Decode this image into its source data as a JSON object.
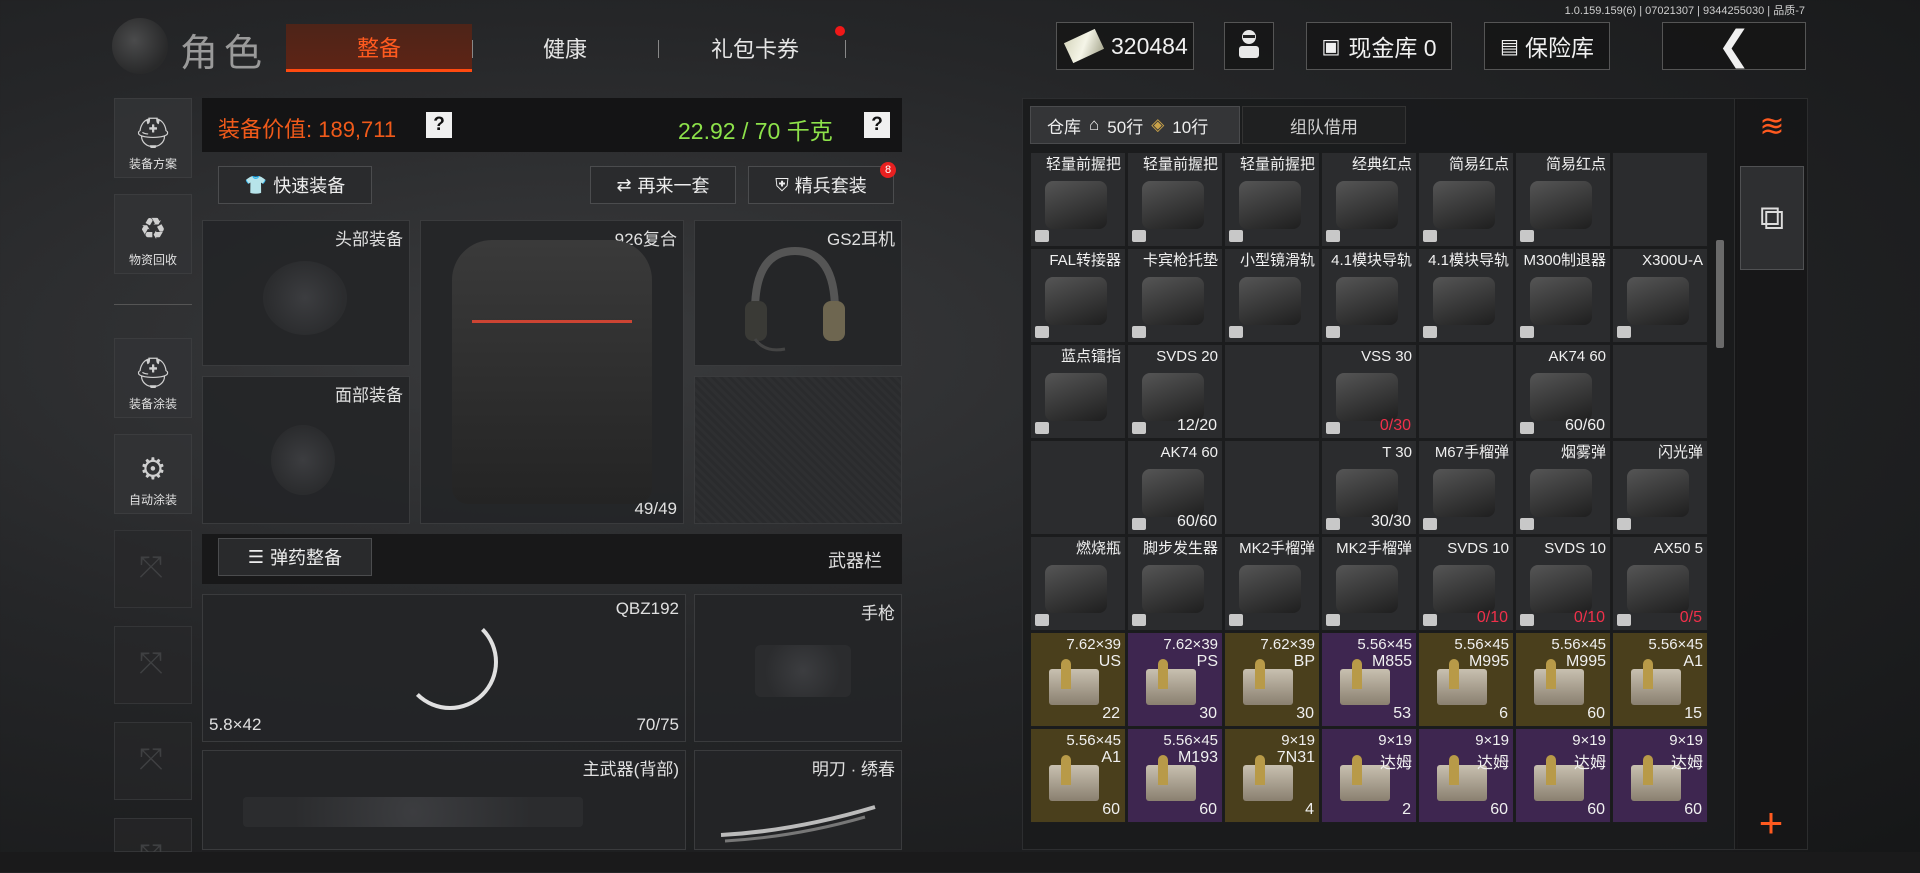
{
  "version": "1.0.159.159(6) | 07021307 | 9344255030 | 品质-7",
  "header": {
    "title": "角色",
    "tabs": [
      {
        "label": "整备",
        "active": true
      },
      {
        "label": "健康",
        "active": false
      },
      {
        "label": "礼包卡券",
        "active": false,
        "has_dot": true
      }
    ],
    "money": "320484",
    "cash_vault": "现金库 0",
    "safe": "保险库",
    "back_icon": "back-arrow-icon"
  },
  "sidebar": [
    {
      "label": "装备方案",
      "icon": "helmet-plan-icon"
    },
    {
      "label": "物资回收",
      "icon": "recycle-face-icon"
    },
    {
      "label": "装备涂装",
      "icon": "helmet-paint-icon"
    },
    {
      "label": "自动涂装",
      "icon": "brush-gear-icon"
    }
  ],
  "equipment": {
    "value_label": "装备价值: 189,711",
    "weight_label": "22.92 / 70 千克",
    "quick_equip": "快速装备",
    "again": "再来一套",
    "elite": "精兵套装",
    "elite_badge": "8",
    "slots": {
      "head": "头部装备",
      "face": "面部装备",
      "armor_name": "926复合",
      "armor_durability": "49/49",
      "ears": "GS2耳机",
      "ammo_btn": "弹药整备",
      "weapon_col": "武器栏",
      "primary_name": "QBZ192",
      "primary_caliber": "5.8×42",
      "primary_ammo": "70/75",
      "pistol": "手枪",
      "back_weapon": "主武器(背部)",
      "melee": "明刀 · 绣春"
    }
  },
  "storage": {
    "tab": "仓库",
    "rows": "50行",
    "rows2": "10行",
    "team_tab": "组队借用",
    "items": [
      {
        "name": "轻量前握把",
        "count": "",
        "tier": "gray"
      },
      {
        "name": "轻量前握把",
        "count": "",
        "tier": "gray"
      },
      {
        "name": "轻量前握把",
        "count": "",
        "tier": "gray"
      },
      {
        "name": "经典红点",
        "count": "",
        "tier": "gray"
      },
      {
        "name": "简易红点",
        "count": "",
        "tier": "gray"
      },
      {
        "name": "简易红点",
        "count": "",
        "tier": "gray"
      },
      {
        "name": "",
        "count": "",
        "tier": "gray"
      },
      {
        "name": "FAL转接器",
        "count": "",
        "tier": "gray"
      },
      {
        "name": "卡宾枪托垫",
        "count": "",
        "tier": "gray"
      },
      {
        "name": "小型镜滑轨",
        "count": "",
        "tier": "gray"
      },
      {
        "name": "4.1模块导轨",
        "count": "",
        "tier": "gray"
      },
      {
        "name": "4.1模块导轨",
        "count": "",
        "tier": "gray"
      },
      {
        "name": "M300制退器",
        "count": "",
        "tier": "gray"
      },
      {
        "name": "X300U-A",
        "count": "",
        "tier": "gray"
      },
      {
        "name": "蓝点镭指",
        "count": "",
        "tier": "gray"
      },
      {
        "name": "SVDS 20",
        "count": "12/20",
        "tier": "gray"
      },
      {
        "name": "",
        "count": "",
        "tier": "gray"
      },
      {
        "name": "VSS 30",
        "count": "0/30",
        "tier": "gray",
        "red": true
      },
      {
        "name": "",
        "count": "",
        "tier": "gray"
      },
      {
        "name": "AK74 60",
        "count": "60/60",
        "tier": "gray"
      },
      {
        "name": "",
        "count": "",
        "tier": "gray"
      },
      {
        "name": "",
        "count": "",
        "tier": "gray"
      },
      {
        "name": "AK74 60",
        "count": "60/60",
        "tier": "gray"
      },
      {
        "name": "",
        "count": "",
        "tier": "gray"
      },
      {
        "name": "T 30",
        "count": "30/30",
        "tier": "gray"
      },
      {
        "name": "M67手榴弹",
        "count": "",
        "tier": "gray"
      },
      {
        "name": "烟雾弹",
        "count": "",
        "tier": "gray"
      },
      {
        "name": "闪光弹",
        "count": "",
        "tier": "gray"
      },
      {
        "name": "燃烧瓶",
        "count": "",
        "tier": "gray"
      },
      {
        "name": "脚步发生器",
        "count": "",
        "tier": "gray"
      },
      {
        "name": "MK2手榴弹",
        "count": "",
        "tier": "gray"
      },
      {
        "name": "MK2手榴弹",
        "count": "",
        "tier": "gray"
      },
      {
        "name": "SVDS 10",
        "count": "0/10",
        "tier": "gray",
        "red": true
      },
      {
        "name": "SVDS 10",
        "count": "0/10",
        "tier": "gray",
        "red": true
      },
      {
        "name": "AX50 5",
        "count": "0/5",
        "tier": "gray",
        "red": true
      },
      {
        "name": "7.62×39",
        "sub": "US",
        "count": "22",
        "tier": "gold"
      },
      {
        "name": "7.62×39",
        "sub": "PS",
        "count": "30",
        "tier": "purple"
      },
      {
        "name": "7.62×39",
        "sub": "BP",
        "count": "30",
        "tier": "gold"
      },
      {
        "name": "5.56×45",
        "sub": "M855",
        "count": "53",
        "tier": "purple"
      },
      {
        "name": "5.56×45",
        "sub": "M995",
        "count": "6",
        "tier": "gold"
      },
      {
        "name": "5.56×45",
        "sub": "M995",
        "count": "60",
        "tier": "gold"
      },
      {
        "name": "5.56×45",
        "sub": "A1",
        "count": "15",
        "tier": "gold"
      },
      {
        "name": "5.56×45",
        "sub": "A1",
        "count": "60",
        "tier": "gold"
      },
      {
        "name": "5.56×45",
        "sub": "M193",
        "count": "60",
        "tier": "purple"
      },
      {
        "name": "9×19",
        "sub": "7N31",
        "count": "4",
        "tier": "gold"
      },
      {
        "name": "9×19",
        "sub": "达姆",
        "count": "2",
        "tier": "purple"
      },
      {
        "name": "9×19",
        "sub": "达姆",
        "count": "60",
        "tier": "purple"
      },
      {
        "name": "9×19",
        "sub": "达姆",
        "count": "60",
        "tier": "purple"
      },
      {
        "name": "9×19",
        "sub": "达姆",
        "count": "60",
        "tier": "purple"
      }
    ]
  },
  "right_column": {
    "sort_icon": "sort-layers-icon",
    "layer_icon": "stack-download-icon",
    "add": "+"
  }
}
